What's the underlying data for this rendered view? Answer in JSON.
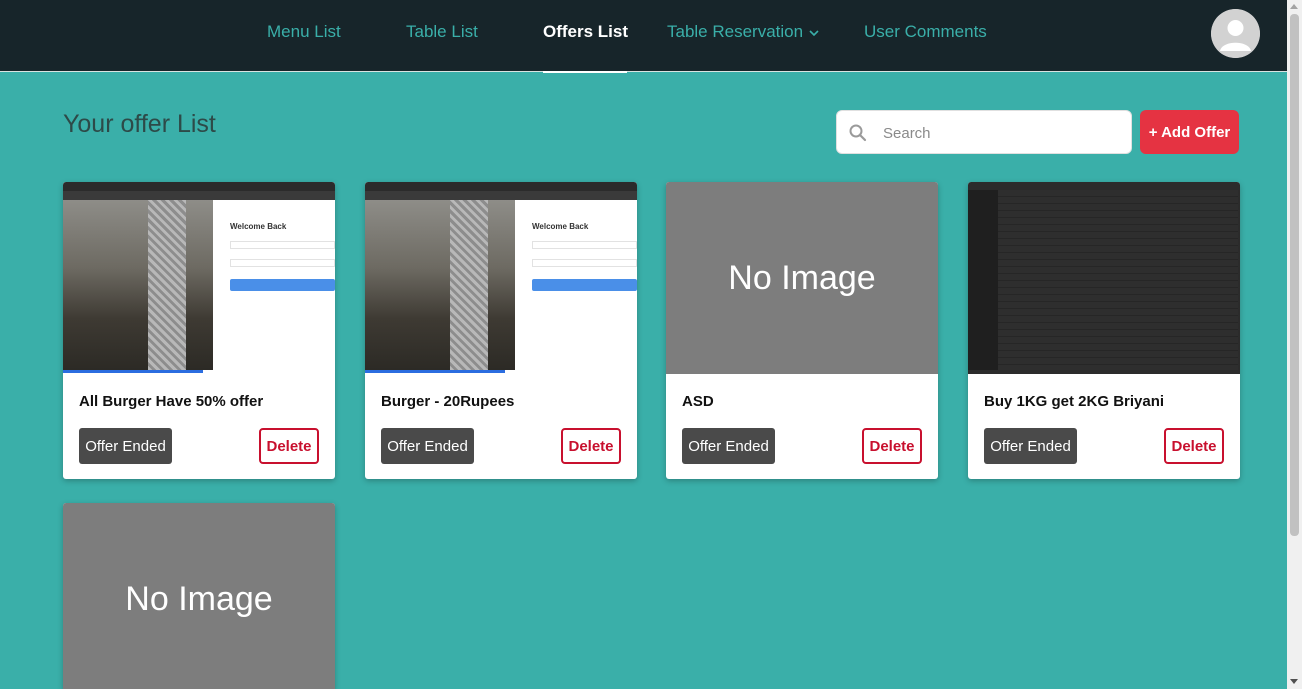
{
  "nav": {
    "links": [
      {
        "label": "Menu List"
      },
      {
        "label": "Table List"
      },
      {
        "label": "Offers List"
      },
      {
        "label": "Table Reservation"
      },
      {
        "label": "User Comments"
      }
    ],
    "active_index": 2
  },
  "header": {
    "title": "Your offer List",
    "search_placeholder": "Search",
    "add_button_label": "+ Add Offer"
  },
  "offers": [
    {
      "title": "All Burger Have 50% offer",
      "image": "screenshot",
      "status_label": "Offer Ended",
      "delete_label": "Delete"
    },
    {
      "title": "Burger - 20Rupees",
      "image": "screenshot",
      "status_label": "Offer Ended",
      "delete_label": "Delete"
    },
    {
      "title": "ASD",
      "image": "none",
      "no_image_label": "No Image",
      "status_label": "Offer Ended",
      "delete_label": "Delete"
    },
    {
      "title": "Buy 1KG get 2KG Briyani",
      "image": "screenshot",
      "status_label": "Offer Ended",
      "delete_label": "Delete"
    },
    {
      "image": "none",
      "no_image_label": "No Image"
    }
  ],
  "thumbnail_text": {
    "welcome": "Welcome Back"
  },
  "colors": {
    "background": "#3aafa9",
    "navbar": "#17252a",
    "nav_link": "#3aafa9",
    "add_button": "#e53342",
    "delete": "#c8102e",
    "ended_button": "#4a4a4a"
  }
}
